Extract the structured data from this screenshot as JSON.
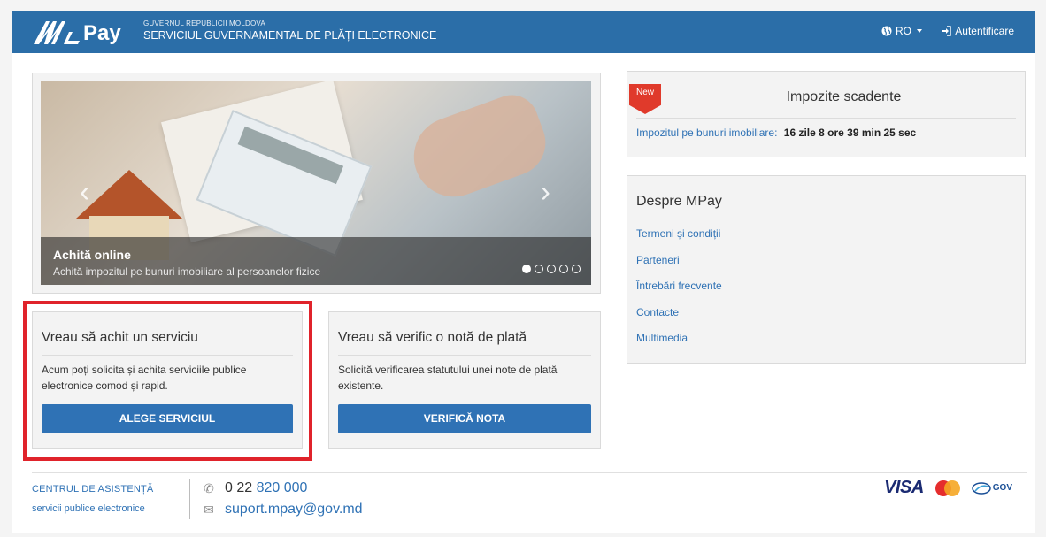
{
  "header": {
    "logo_text": "Pay",
    "org_small": "GUVERNUL REPUBLICII MOLDOVA",
    "org_big": "SERVICIUL GUVERNAMENTAL DE PLĂȚI ELECTRONICE",
    "lang": "RO",
    "auth": "Autentificare"
  },
  "carousel": {
    "title": "Achită online",
    "subtitle": "Achită impozitul pe bunuri imobiliare al persoanelor fizice",
    "slides": 5,
    "active_slide": 1
  },
  "cards": {
    "pay": {
      "title": "Vreau să achit un serviciu",
      "desc": "Acum poți solicita și achita serviciile publice electronice comod și rapid.",
      "button": "ALEGE SERVICIUL"
    },
    "verify": {
      "title": "Vreau să verific o notă de plată",
      "desc": "Solicită verificarea statutului unei note de plată existente.",
      "button": "VERIFICĂ NOTA"
    }
  },
  "taxes": {
    "badge": "New",
    "title": "Impozite scadente",
    "link": "Impozitul pe bunuri imobiliare:",
    "countdown": "16 zile 8 ore 39 min 25 sec"
  },
  "about": {
    "title": "Despre MPay",
    "links": [
      "Termeni și condiții",
      "Parteneri",
      "Întrebări frecvente",
      "Contacte",
      "Multimedia"
    ]
  },
  "footer": {
    "help_title": "CENTRUL DE ASISTENȚĂ",
    "help_sub": "servicii publice electronice",
    "phone_prefix": "0 22 ",
    "phone_number": "820 000",
    "email": "suport.mpay@gov.md",
    "visa": "VISA",
    "gov": "GOV"
  },
  "colors": {
    "header": "#2b6ea8",
    "button": "#2f72b5",
    "highlight": "#e0232b",
    "badge": "#e03a2b"
  }
}
